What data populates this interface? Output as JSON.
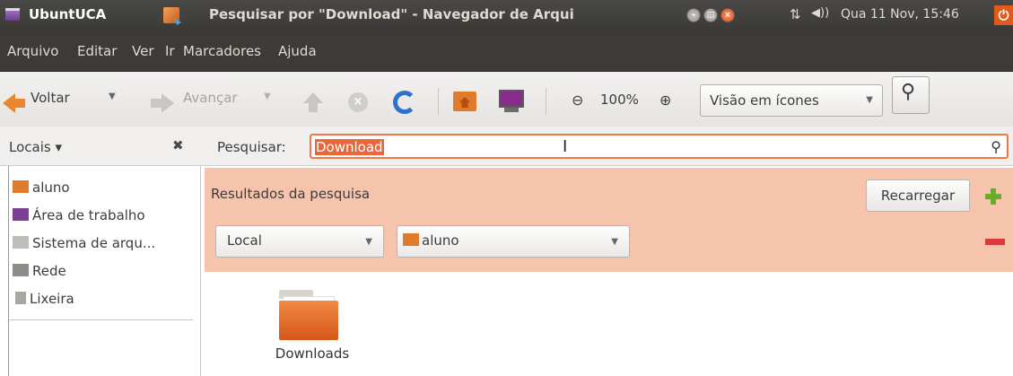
{
  "top_panel": {
    "app_name": "UbuntUCA",
    "window_title": "Pesquisar por \"Download\" - Navegador de Arqui",
    "clock": "Qua 11 Nov, 15:46"
  },
  "menubar": {
    "items": [
      "Arquivo",
      "Editar",
      "Ver",
      "Ir",
      "Marcadores",
      "Ajuda"
    ]
  },
  "toolbar": {
    "back_label": "Voltar",
    "forward_label": "Avançar",
    "zoom": "100%",
    "view_mode": "Visão em ícones"
  },
  "search_row": {
    "places_label": "Locais ▾",
    "search_label": "Pesquisar:",
    "search_value": "Download"
  },
  "sidebar": {
    "items": [
      {
        "label": "aluno",
        "icon": "home-folder-icon"
      },
      {
        "label": "Área de trabalho",
        "icon": "desktop-icon"
      },
      {
        "label": "Sistema de arqu...",
        "icon": "drive-icon"
      },
      {
        "label": "Rede",
        "icon": "network-icon"
      },
      {
        "label": "Lixeira",
        "icon": "trash-icon"
      }
    ]
  },
  "search_panel": {
    "title": "Resultados da pesquisa",
    "reload_label": "Recarregar",
    "criteria_type": "Local",
    "criteria_location": "aluno"
  },
  "content": {
    "items": [
      {
        "label": "Downloads",
        "icon": "folder-icon"
      }
    ]
  },
  "colors": {
    "accent": "#e8673c",
    "panel_bg": "#3c3b37",
    "search_panel_bg": "#f6c4ad"
  }
}
